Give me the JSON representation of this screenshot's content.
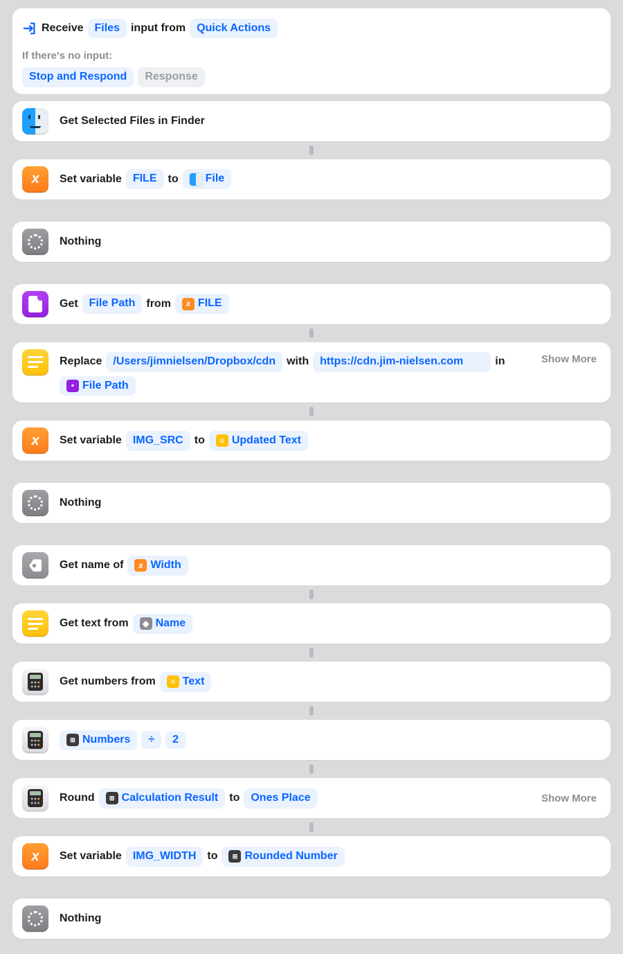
{
  "input_block": {
    "receive": "Receive",
    "type_token": "Files",
    "input_from": "input from",
    "source_token": "Quick Actions",
    "no_input_label": "If there's no input:",
    "no_input_action": "Stop and Respond",
    "no_input_response_placeholder": "Response"
  },
  "steps": [
    {
      "id": "finder",
      "title": "Get Selected Files in Finder"
    },
    {
      "id": "setfile",
      "prefix": "Set variable",
      "var": "FILE",
      "to": "to",
      "result": "File"
    },
    {
      "id": "nothing1",
      "title": "Nothing"
    },
    {
      "id": "getpath",
      "prefix": "Get",
      "detail": "File Path",
      "from": "from",
      "var": "FILE"
    },
    {
      "id": "replace",
      "prefix": "Replace",
      "find": "/Users/jimnielsen/Dropbox/cdn",
      "with": "with",
      "repl": "https://cdn.jim-nielsen.com",
      "in": "in",
      "src": "File Path",
      "showmore": "Show More"
    },
    {
      "id": "setimgsrc",
      "prefix": "Set variable",
      "var": "IMG_SRC",
      "to": "to",
      "result": "Updated Text"
    },
    {
      "id": "nothing2",
      "title": "Nothing"
    },
    {
      "id": "getname",
      "prefix": "Get name of",
      "var": "Width"
    },
    {
      "id": "gettext",
      "prefix": "Get text from",
      "src": "Name"
    },
    {
      "id": "getnums",
      "prefix": "Get numbers from",
      "src": "Text"
    },
    {
      "id": "calc",
      "src": "Numbers",
      "op": "÷",
      "operand": "2"
    },
    {
      "id": "round",
      "prefix": "Round",
      "src": "Calculation Result",
      "to": "to",
      "place": "Ones Place",
      "showmore": "Show More"
    },
    {
      "id": "setwidth",
      "prefix": "Set variable",
      "var": "IMG_WIDTH",
      "to": "to",
      "result": "Rounded Number"
    },
    {
      "id": "nothing3",
      "title": "Nothing"
    }
  ]
}
